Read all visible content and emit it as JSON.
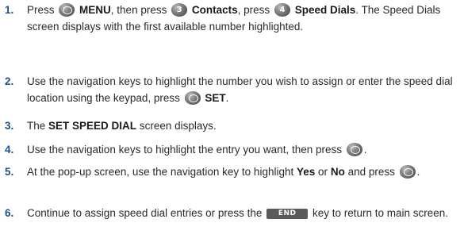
{
  "steps": [
    {
      "num": "1.",
      "parts": {
        "a": "Press",
        "b": "MENU",
        "c": ", then press",
        "d": "Contacts",
        "e": ", press",
        "f": "Speed Dials",
        "g": ". The Speed Dials screen displays with the first available number highlighted.",
        "icon_digit_3": "3",
        "icon_digit_4": "4"
      }
    },
    {
      "num": "2.",
      "parts": {
        "a": "Use the navigation keys to highlight the number you wish to assign or enter the speed dial location using the keypad, press",
        "b": "SET",
        "c": "."
      }
    },
    {
      "num": "3.",
      "parts": {
        "a": "The",
        "b": "SET SPEED DIAL",
        "c": "screen displays."
      }
    },
    {
      "num": "4.",
      "parts": {
        "a": "Use the navigation keys to highlight the entry you want, then press",
        "b": "."
      }
    },
    {
      "num": "5.",
      "parts": {
        "a": "At the pop-up screen, use the navigation key to highlight",
        "b": "Yes",
        "c": "or",
        "d": "No",
        "e": "and press",
        "f": "."
      }
    },
    {
      "num": "6.",
      "parts": {
        "a": "Continue to assign speed dial entries or press the",
        "b": "key to return to main screen.",
        "end_key_label": "END"
      }
    }
  ],
  "icons": {
    "ok_key": "ok-key-icon",
    "number_key": "number-key-icon",
    "end_key": "end-key-icon"
  }
}
